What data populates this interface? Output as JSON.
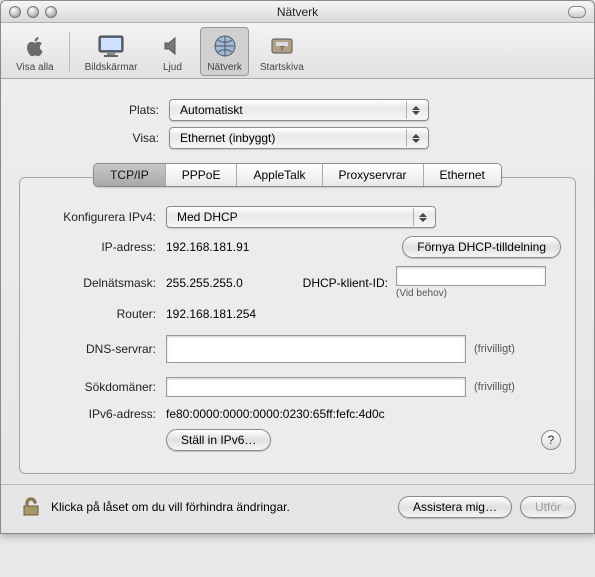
{
  "window": {
    "title": "Nätverk"
  },
  "toolbar": {
    "items": [
      {
        "label": "Visa alla"
      },
      {
        "label": "Bildskärmar"
      },
      {
        "label": "Ljud"
      },
      {
        "label": "Nätverk"
      },
      {
        "label": "Startskiva"
      }
    ]
  },
  "top": {
    "location_label": "Plats:",
    "location_value": "Automatiskt",
    "show_label": "Visa:",
    "show_value": "Ethernet (inbyggt)"
  },
  "tabs": {
    "items": [
      "TCP/IP",
      "PPPoE",
      "AppleTalk",
      "Proxyservrar",
      "Ethernet"
    ],
    "active_index": 0
  },
  "pane": {
    "configure_label": "Konfigurera IPv4:",
    "configure_value": "Med DHCP",
    "ip_label": "IP-adress:",
    "ip_value": "192.168.181.91",
    "renew_button": "Förnya DHCP-tilldelning",
    "subnet_label": "Delnätsmask:",
    "subnet_value": "255.255.255.0",
    "client_id_label": "DHCP-klient-ID:",
    "client_id_value": "",
    "client_id_hint": "(Vid behov)",
    "router_label": "Router:",
    "router_value": "192.168.181.254",
    "dns_label": "DNS-servrar:",
    "dns_value": "",
    "search_label": "Sökdomäner:",
    "search_value": "",
    "optional": "(frivilligt)",
    "ipv6addr_label": "IPv6-adress:",
    "ipv6addr_value": "fe80:0000:0000:0000:0230:65ff:fefc:4d0c",
    "ipv6_button": "Ställ in IPv6…",
    "help": "?"
  },
  "footer": {
    "lock_text": "Klicka på låset om du vill förhindra ändringar.",
    "assist_button": "Assistera mig…",
    "apply_button": "Utför"
  }
}
